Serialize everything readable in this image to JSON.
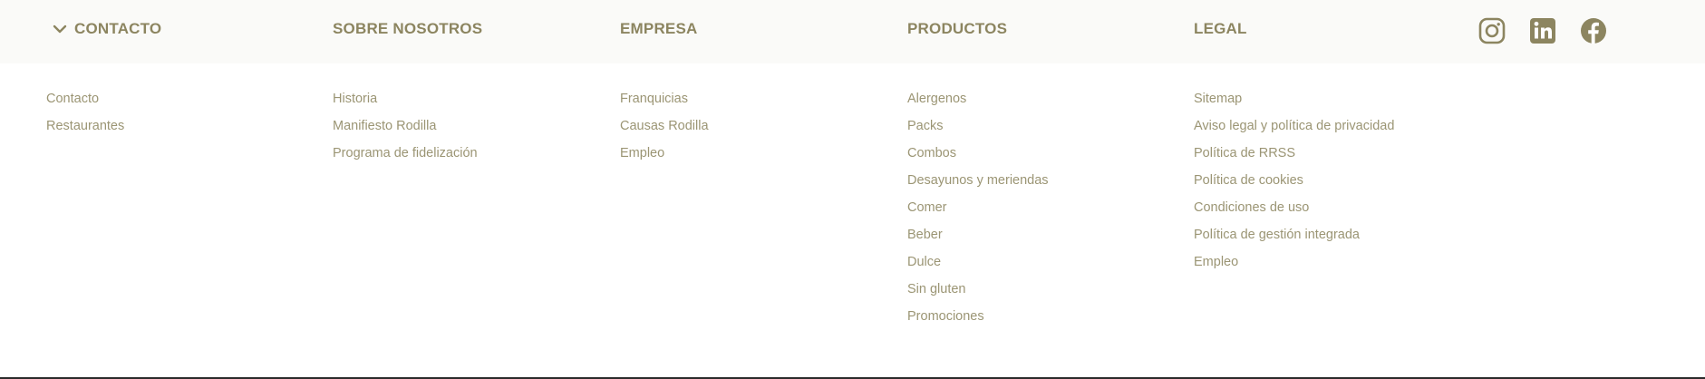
{
  "footer": {
    "columns": [
      {
        "title": "CONTACTO",
        "links": [
          "Contacto",
          "Restaurantes"
        ]
      },
      {
        "title": "SOBRE NOSOTROS",
        "links": [
          "Historia",
          "Manifiesto Rodilla",
          "Programa de fidelización"
        ]
      },
      {
        "title": "EMPRESA",
        "links": [
          "Franquicias",
          "Causas Rodilla",
          "Empleo"
        ]
      },
      {
        "title": "PRODUCTOS",
        "links": [
          "Alergenos",
          "Packs",
          "Combos",
          "Desayunos y meriendas",
          "Comer",
          "Beber",
          "Dulce",
          "Sin gluten",
          "Promociones"
        ]
      },
      {
        "title": "LEGAL",
        "links": [
          "Sitemap",
          "Aviso legal y política de privacidad",
          "Política de RRSS",
          "Política de cookies",
          "Condiciones de uso",
          "Política de gestión integrada",
          "Empleo"
        ]
      }
    ],
    "social": [
      {
        "icon": "instagram-icon"
      },
      {
        "icon": "linkedin-icon"
      },
      {
        "icon": "facebook-icon"
      }
    ],
    "colors": {
      "accent": "#8c8560",
      "link": "#9b9574",
      "header_band": "#fafaf8"
    }
  }
}
